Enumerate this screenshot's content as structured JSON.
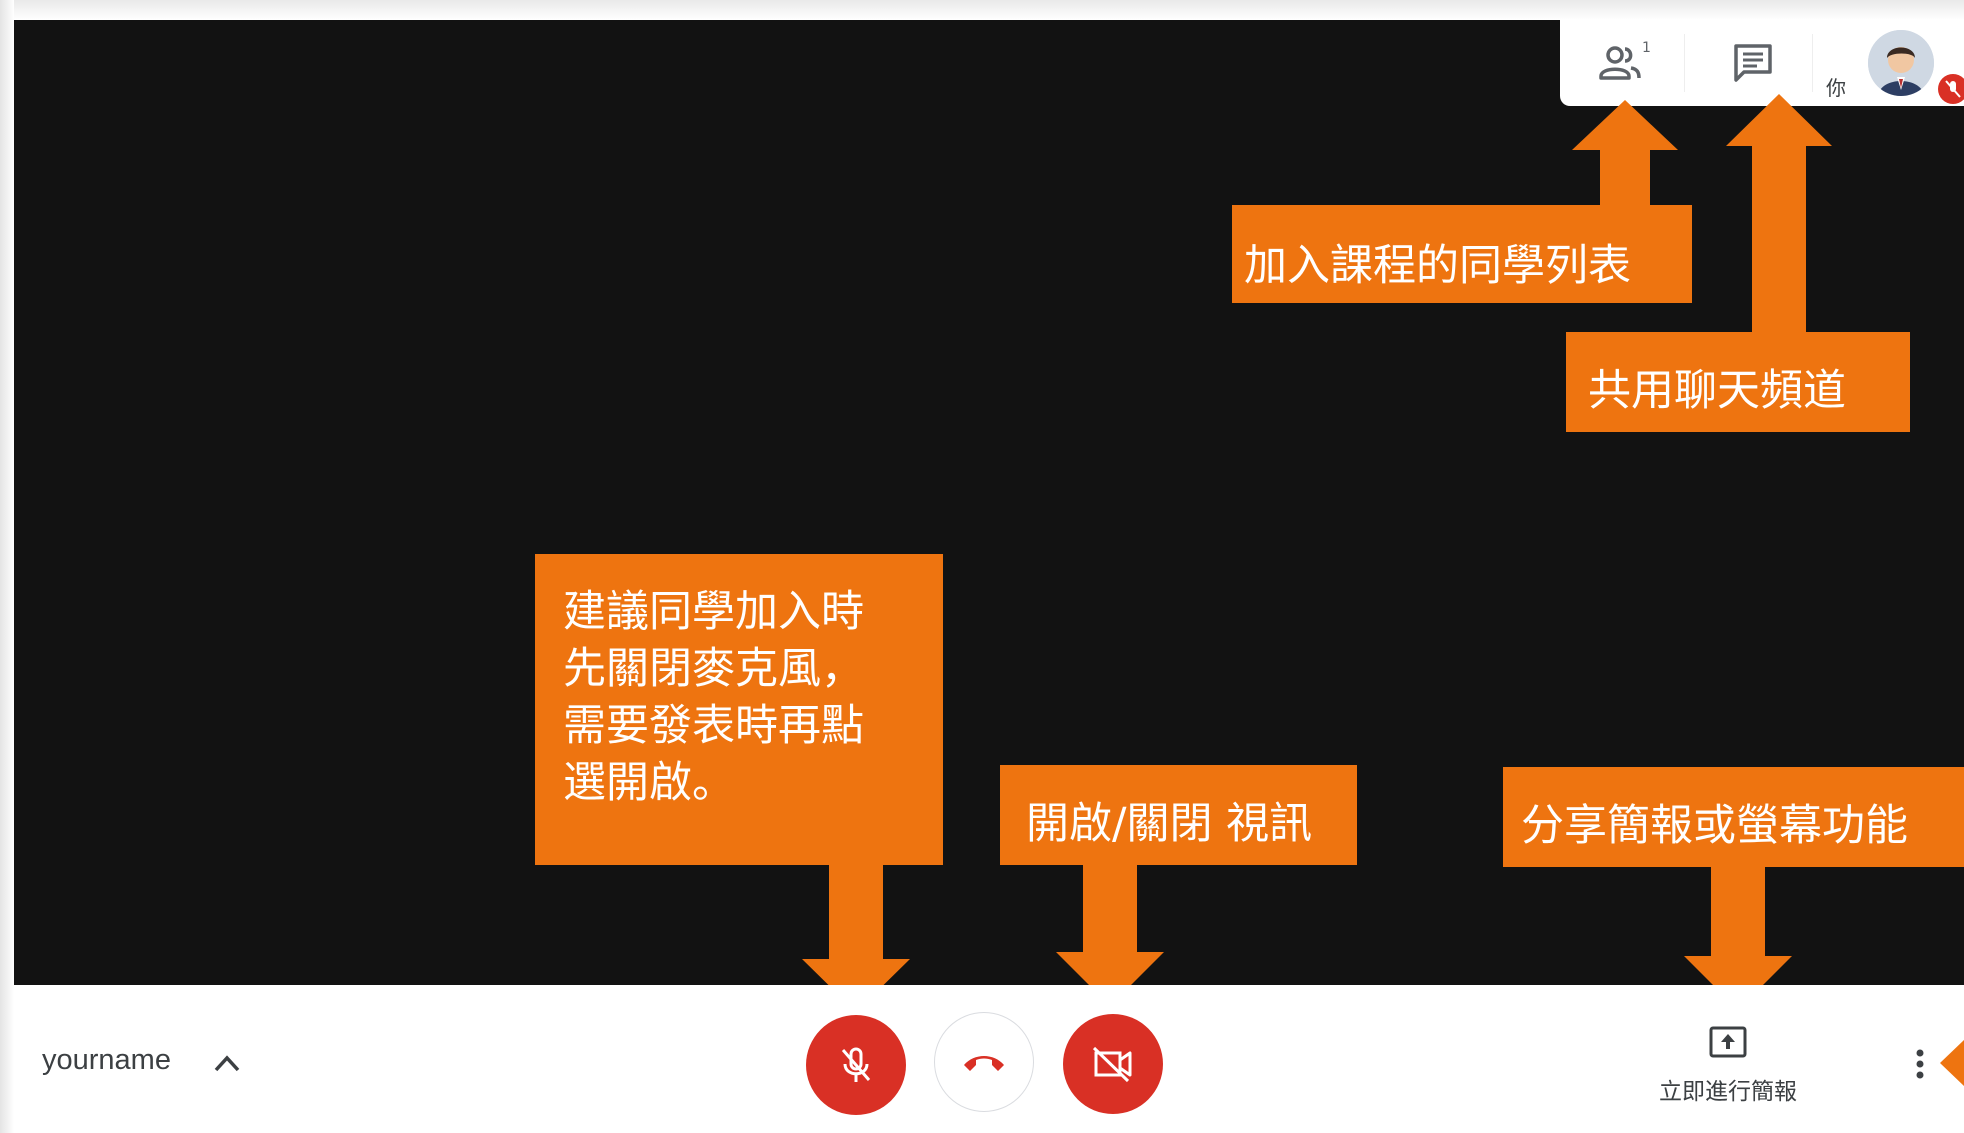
{
  "meeting": {
    "self_label": "你",
    "participant_count": "1",
    "display_name": "yourname",
    "present_label": "立即進行簡報"
  },
  "callouts": {
    "people_list": "加入課程的同學列表",
    "chat": "共用聊天頻道",
    "mic": [
      "建議同學加入時",
      "先關閉麥克風，",
      "需要發表時再點",
      "選開啟。"
    ],
    "camera": "開啟/關閉 視訊",
    "present": "分享簡報或螢幕功能"
  },
  "icons": {
    "people": "people-icon",
    "chat": "chat-icon",
    "mic_off": "mic-off-icon",
    "hang_up": "phone-hangup-icon",
    "camera_off": "videocam-off-icon",
    "present": "present-screen-icon",
    "more": "more-vert-icon",
    "chevron": "chevron-up-icon"
  },
  "colors": {
    "callout": "#ee7410",
    "danger": "#d93025",
    "video_bg": "#121212",
    "icon_gray": "#5f6368"
  }
}
